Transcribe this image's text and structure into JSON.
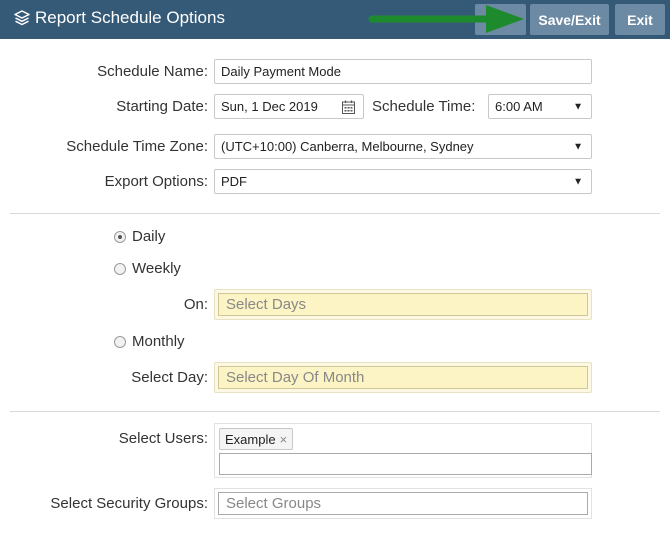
{
  "header": {
    "title": "Report Schedule Options",
    "save_exit_label": "Save/Exit",
    "exit_label": "Exit"
  },
  "form": {
    "schedule_name_label": "Schedule Name:",
    "schedule_name_value": "Daily Payment Mode",
    "starting_date_label": "Starting Date:",
    "starting_date_value": "Sun, 1 Dec 2019",
    "schedule_time_label": "Schedule Time:",
    "schedule_time_value": "6:00 AM",
    "time_zone_label": "Schedule Time Zone:",
    "time_zone_value": "(UTC+10:00) Canberra, Melbourne, Sydney",
    "export_options_label": "Export Options:",
    "export_options_value": "PDF"
  },
  "frequency": {
    "daily_label": "Daily",
    "weekly_label": "Weekly",
    "on_label": "On:",
    "select_days_placeholder": "Select Days",
    "monthly_label": "Monthly",
    "select_day_label": "Select Day:",
    "select_day_of_month_placeholder": "Select Day Of Month",
    "selected": "Daily"
  },
  "recipients": {
    "select_users_label": "Select Users:",
    "users": [
      "Example"
    ],
    "remove_glyph": "×",
    "select_groups_label": "Select Security Groups:",
    "select_groups_placeholder": "Select Groups"
  },
  "glyphs": {
    "caret": "▼"
  },
  "colors": {
    "header_bg": "#355a78",
    "button_bg": "#6d8aa4",
    "arrow": "#1e8a2e",
    "highlight_field": "#fcf4c4"
  }
}
